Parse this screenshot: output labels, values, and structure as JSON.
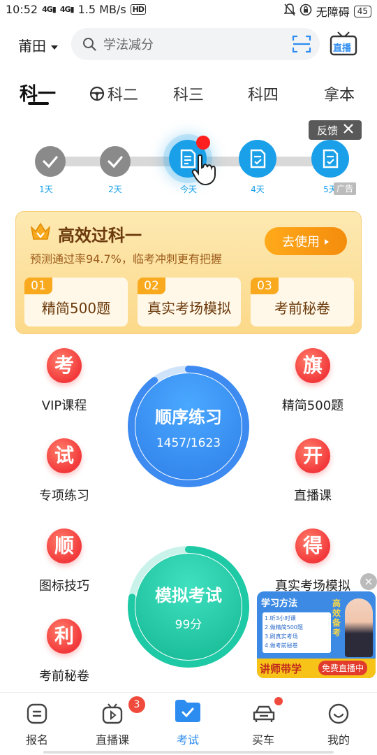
{
  "status_bar": {
    "time": "10:52",
    "signal1": "4G",
    "signal2": "4G",
    "speed": "1.5 MB/s",
    "hd": "HD",
    "accessibility": "无障碍",
    "battery": "45"
  },
  "header": {
    "city": "莆田",
    "search_placeholder": "学法减分",
    "live_label": "直播"
  },
  "tabs": [
    "科一",
    "科二",
    "科三",
    "科四",
    "拿本"
  ],
  "study_plan": {
    "feedback_label": "反馈",
    "ad_label": "广告",
    "steps": [
      {
        "label": "1天",
        "status": "done"
      },
      {
        "label": "2天",
        "status": "done"
      },
      {
        "label": "今天",
        "status": "current"
      },
      {
        "label": "4天",
        "status": "todo"
      },
      {
        "label": "5天",
        "status": "todo"
      }
    ]
  },
  "promo": {
    "title": "高效过科一",
    "subtitle": "预测通过率94.7%，临考冲刺更有把握",
    "button": "去使用",
    "cards": [
      {
        "num": "01",
        "label": "精简500题"
      },
      {
        "num": "02",
        "label": "真实考场模拟"
      },
      {
        "num": "03",
        "label": "考前秘卷"
      }
    ]
  },
  "grid_left": [
    {
      "glyph": "考",
      "label": "VIP课程"
    },
    {
      "glyph": "试",
      "label": "专项练习"
    },
    {
      "glyph": "顺",
      "label": "图标技巧"
    },
    {
      "glyph": "利",
      "label": "考前秘卷"
    }
  ],
  "grid_right": [
    {
      "glyph": "旗",
      "label": "精简500题"
    },
    {
      "glyph": "开",
      "label": "直播课"
    },
    {
      "glyph": "得",
      "label": "真实考场模拟"
    }
  ],
  "practice": {
    "title": "顺序练习",
    "progress": "1457/1623",
    "progress_fraction": 0.898
  },
  "exam": {
    "title": "模拟考试",
    "score": "99分"
  },
  "float_ad": {
    "heading": "学习方法",
    "items": [
      "1.听3小时课",
      "2.做精简500题",
      "3.刷真实考场",
      "4.做考前秘卷"
    ],
    "side_text": "高效备考",
    "brand": "讲师带学",
    "live": "免费直播中"
  },
  "bottom_nav": {
    "items": [
      {
        "label": "报名",
        "icon": "signup-icon"
      },
      {
        "label": "直播课",
        "icon": "tv-icon"
      },
      {
        "label": "考试",
        "icon": "exam-folder-icon"
      },
      {
        "label": "买车",
        "icon": "car-icon"
      },
      {
        "label": "我的",
        "icon": "profile-icon"
      }
    ],
    "live_badge": "3",
    "active": "考试"
  },
  "colors": {
    "primary_blue": "#2d8cf0",
    "step_blue": "#1aa0e8",
    "red_icon": "#f2383a",
    "promo_orange": "#f9a91d",
    "teal": "#17c9a8"
  }
}
